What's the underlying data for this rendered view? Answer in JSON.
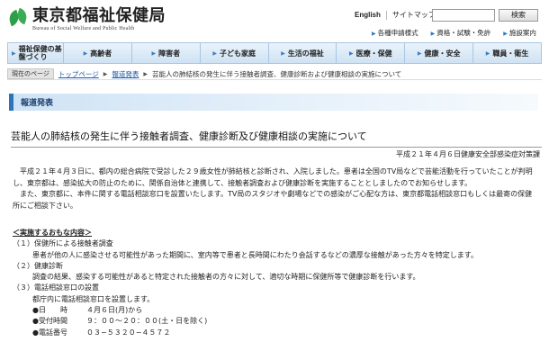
{
  "header": {
    "site_title": "東京都福祉保健局",
    "site_subtitle": "Bureau of Social Welfare and Public Health",
    "util_links": [
      "English",
      "サイトマップ"
    ],
    "search_button": "検索",
    "sub_links": [
      "各種申請様式",
      "資格・試験・免許",
      "施設案内"
    ]
  },
  "nav": {
    "items": [
      "福祉保健の基盤づくり",
      "高齢者",
      "障害者",
      "子ども家庭",
      "生活の福祉",
      "医療・保健",
      "健康・安全",
      "職員・衛生"
    ]
  },
  "breadcrumb": {
    "label": "現在のページ",
    "home": "トップページ",
    "parent": "報道発表",
    "current": "芸能人の肺結核の発生に伴う接触者調査、健康診断および健康相談の実施について"
  },
  "section": {
    "heading": "報道発表"
  },
  "article": {
    "title": "芸能人の肺結核の発生に伴う接触者調査、健康診断及び健康相談の実施について",
    "date_line": "平成２１年４月６日健康安全部感染症対策課",
    "paragraph1": "平成２１年４月３日に、都内の総合病院で受診した２９歳女性が肺結核と診断され、入院しました。患者は全国のTV局などで芸能活動を行っていたことが判明し、東京都は、感染拡大の防止のために、関係自治体と連携して、接触者調査および健康診断を実施することとしましたのでお知らせします。",
    "paragraph2": "また、東京都に、本件に関する電話相談窓口を設置いたします。TV局のスタジオや劇場などでの感染がご心配な方は、東京都電話相談窓口もしくは最寄の保健所にご相談下さい。",
    "items_heading": "＜実施するおもな内容＞",
    "item1_title": "（１）保健所による接触者調査",
    "item1_body": "患者が他の人に感染させる可能性があった期間に、室内等で患者と長時間にわたり会話するなどの濃厚な接触があった方々を特定します。",
    "item2_title": "（２）健康診断",
    "item2_body": "調査の結果、感染する可能性があると特定された接触者の方々に対して、適切な時期に保健所等で健康診断を行います。",
    "item3_title": "（３）電話相談窓口の設置",
    "item3_body": "都庁内に電話相談窓口を設置します。",
    "details": [
      {
        "label": "●日　　時",
        "value": "４月６日(月)から"
      },
      {
        "label": "●受付時間",
        "value": "９：００〜２０：００(土・日を除く)"
      },
      {
        "label": "●電話番号",
        "value": "０３−５３２０−４５７２"
      }
    ]
  }
}
